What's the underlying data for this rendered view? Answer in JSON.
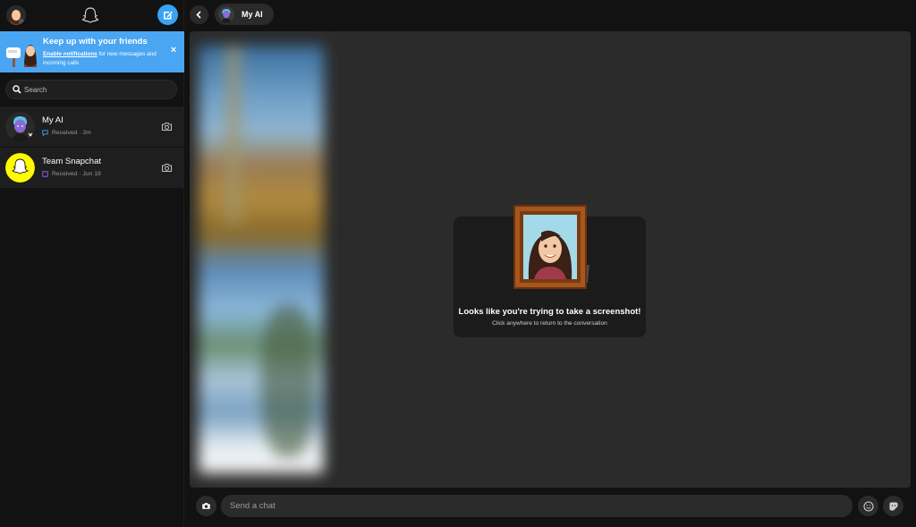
{
  "colors": {
    "accent": "#3aa3f5",
    "banner_bg": "#4aa5f3",
    "snap_yellow": "#fffc00",
    "ai_status": "#3aa3f5",
    "snap_status": "#a05cff"
  },
  "header": {
    "profile_icon": "bitmoji-avatar",
    "ghost_icon": "snapchat-ghost-icon",
    "new_chat_icon": "new-chat-icon"
  },
  "banner": {
    "title": "Keep up with your friends",
    "link_text": "Enable notifications",
    "body_text": " for new messages and incoming calls",
    "close_label": "×"
  },
  "search": {
    "placeholder": "Search"
  },
  "chats": [
    {
      "name": "My AI",
      "status": "Received · 2m"
    },
    {
      "name": "Team Snapchat",
      "status": "Received · Jun 19"
    }
  ],
  "conversation": {
    "contact_name": "My AI",
    "overlay_title": "Looks like you're trying to take a screenshot!",
    "overlay_subtitle": "Click anywhere to return to the conversation"
  },
  "composer": {
    "placeholder": "Send a chat"
  }
}
